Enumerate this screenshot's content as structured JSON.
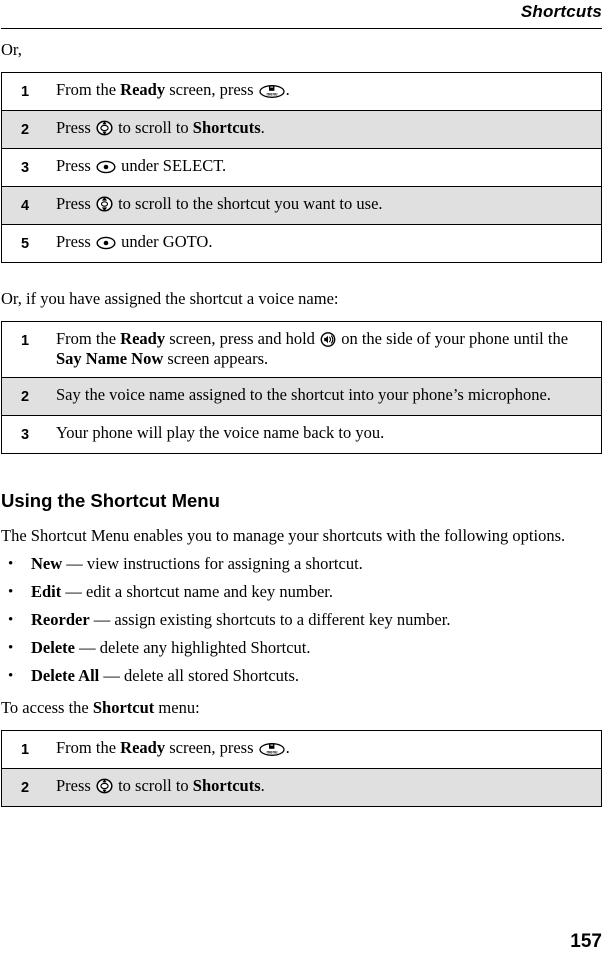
{
  "header": {
    "title": "Shortcuts"
  },
  "page_number": "157",
  "lead_or": "Or,",
  "table_goto": {
    "rows": [
      {
        "num": "1",
        "pre": "From the ",
        "bold1": "Ready",
        "mid": " screen, press ",
        "icon": "menu-key-icon",
        "post": "."
      },
      {
        "num": "2",
        "pre": "Press ",
        "icon": "scroll-wheel-icon",
        "mid": " to scroll to ",
        "bold1": "Shortcuts",
        "post": "."
      },
      {
        "num": "3",
        "pre": "Press ",
        "icon": "softkey-icon",
        "mid": " under SELECT.",
        "bold1": "",
        "post": ""
      },
      {
        "num": "4",
        "pre": "Press ",
        "icon": "updown-scroll-icon",
        "mid": " to scroll to the shortcut you want to use.",
        "bold1": "",
        "post": ""
      },
      {
        "num": "5",
        "pre": "Press ",
        "icon": "softkey-icon",
        "mid": " under GOTO.",
        "bold1": "",
        "post": ""
      }
    ]
  },
  "intro_voice": "Or, if you have assigned the shortcut a voice name:",
  "table_voice": {
    "rows": [
      {
        "num": "1",
        "pre": "From the ",
        "bold1": "Ready",
        "mid": " screen, press and hold ",
        "icon": "speaker-key-icon",
        "post": " on the side of your phone until the ",
        "bold2": "Say Name Now",
        "tail": " screen appears."
      },
      {
        "num": "2",
        "pre": "Say the voice name assigned to the shortcut into your phone’s microphone.",
        "bold1": "",
        "mid": "",
        "icon": "",
        "post": ""
      },
      {
        "num": "3",
        "pre": "Your phone will play the voice name back to you.",
        "bold1": "",
        "mid": "",
        "icon": "",
        "post": ""
      }
    ]
  },
  "section": {
    "heading": "Using the Shortcut Menu",
    "intro": "The Shortcut Menu enables you to manage your shortcuts with the following options.",
    "bullet_char": "•",
    "bullets": [
      {
        "term": "New",
        "dash": " — ",
        "desc": "view instructions for assigning a shortcut."
      },
      {
        "term": "Edit",
        "dash": " — ",
        "desc": "edit a shortcut name and key number."
      },
      {
        "term": "Reorder",
        "dash": " — ",
        "desc": "assign existing shortcuts to a different key number."
      },
      {
        "term": "Delete",
        "dash": " — ",
        "desc": "delete any highlighted Shortcut."
      },
      {
        "term": "Delete All",
        "dash": " — ",
        "desc": "delete all stored Shortcuts."
      }
    ],
    "access_pre": "To access the ",
    "access_bold": "Shortcut",
    "access_post": " menu:"
  },
  "table_access": {
    "rows": [
      {
        "num": "1",
        "pre": "From the ",
        "bold1": "Ready",
        "mid": " screen, press ",
        "icon": "menu-key-icon",
        "post": "."
      },
      {
        "num": "2",
        "pre": "Press ",
        "icon": "scroll-wheel-icon",
        "mid": " to scroll to ",
        "bold1": "Shortcuts",
        "post": "."
      }
    ]
  },
  "colors": {
    "shaded_row": "#e0e0e0",
    "rule": "#000000",
    "text": "#000000"
  }
}
